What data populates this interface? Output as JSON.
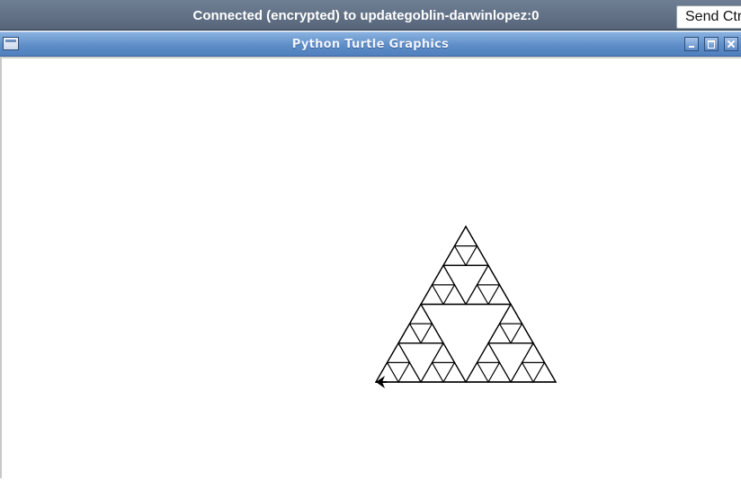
{
  "vnc": {
    "status_text": "Connected (encrypted) to updategoblin-darwinlopez:0",
    "send_button_label": "Send Ctrl-Alt-Del"
  },
  "window": {
    "title": "Python Turtle Graphics"
  },
  "drawing": {
    "shape": "sierpinski-triangle",
    "recursion_depth": 3,
    "stroke_color": "#000000",
    "turtle_icon": "turtle-arrow-icon",
    "turtle_heading": "left"
  },
  "colors": {
    "vnc_bar": "#5f6e82",
    "titlebar": "#5e8dc7",
    "canvas": "#ffffff"
  }
}
